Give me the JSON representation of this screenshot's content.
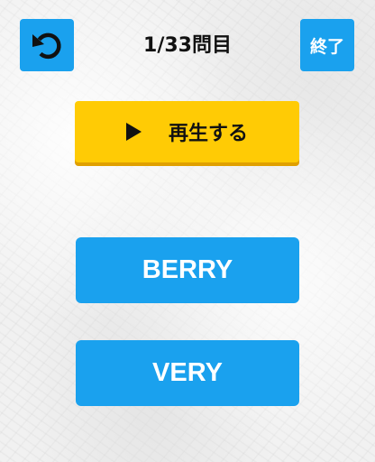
{
  "header": {
    "back_icon": "undo-arrow-icon",
    "progress": "1/33問目",
    "end_label": "終了"
  },
  "play": {
    "icon": "play-icon",
    "label": "再生する"
  },
  "answers": [
    {
      "label": "BERRY"
    },
    {
      "label": "VERY"
    }
  ],
  "colors": {
    "primary_blue": "#1aa1ee",
    "play_yellow": "#ffcb05",
    "play_shadow": "#e0a000",
    "text_dark": "#111111",
    "background": "#f1f1f1"
  }
}
